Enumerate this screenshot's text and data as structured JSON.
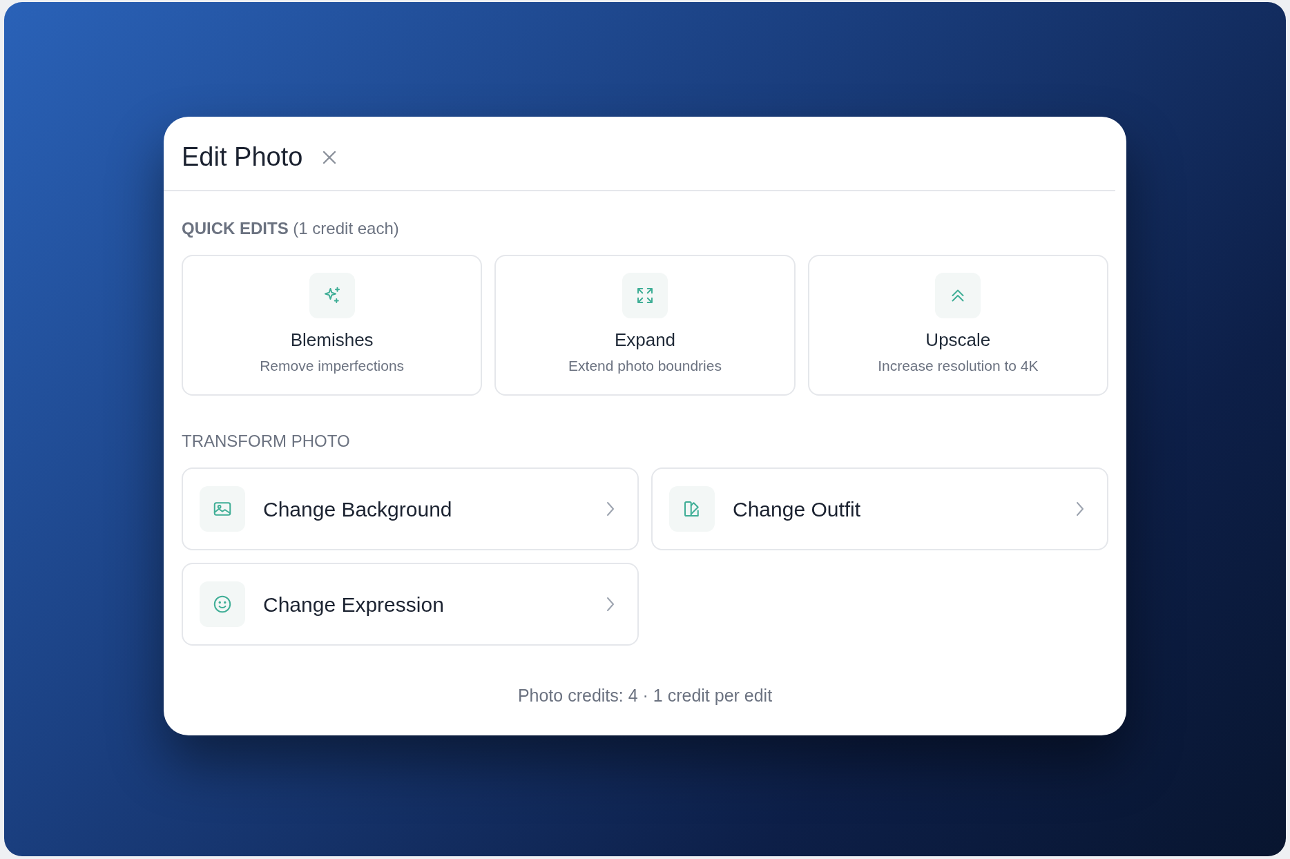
{
  "dialog": {
    "title": "Edit Photo"
  },
  "quick_edits": {
    "heading": "**QUICK EDITS** (1 credit each)",
    "items": [
      {
        "title": "Blemishes",
        "subtitle": "Remove imperfections"
      },
      {
        "title": "Expand",
        "subtitle": "Extend photo boundries"
      },
      {
        "title": "Upscale",
        "subtitle": "Increase resolution to 4K"
      }
    ]
  },
  "transform_photo": {
    "heading": "TRANSFORM PHOTO",
    "items": [
      {
        "label": "Change Background"
      },
      {
        "label": "Change Outfit"
      },
      {
        "label": "Change Expression"
      }
    ]
  },
  "footer": "Photo credits: 4 · 1 credit per edit"
}
